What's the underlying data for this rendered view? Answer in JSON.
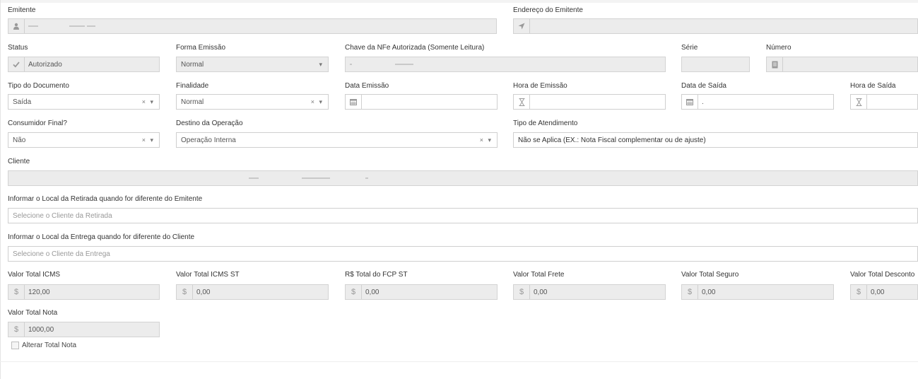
{
  "emitente": {
    "label": "Emitente",
    "icon": "user-icon"
  },
  "endereco": {
    "label": "Endereço do Emitente",
    "icon": "location-arrow-icon"
  },
  "status": {
    "label": "Status",
    "value": "Autorizado",
    "icon": "check-icon"
  },
  "forma_emissao": {
    "label": "Forma Emissão",
    "value": "Normal"
  },
  "chave": {
    "label": "Chave da NFe Autorizada (Somente Leitura)"
  },
  "serie": {
    "label": "Série"
  },
  "numero": {
    "label": "Número",
    "icon": "document-icon"
  },
  "tipo_documento": {
    "label": "Tipo do Documento",
    "value": "Saída",
    "controls": "× ▾"
  },
  "finalidade": {
    "label": "Finalidade",
    "value": "Normal",
    "controls": "× ▾"
  },
  "data_emissao": {
    "label": "Data Emissão",
    "icon": "calendar-icon"
  },
  "hora_emissao": {
    "label": "Hora de Emissão",
    "icon": "hourglass-icon"
  },
  "data_saida": {
    "label": "Data de Saída",
    "icon": "calendar-icon",
    "value": "."
  },
  "hora_saida": {
    "label": "Hora de Saída",
    "icon": "hourglass-icon"
  },
  "consumidor_final": {
    "label": "Consumidor Final?",
    "value": "Não",
    "controls": "× ▾"
  },
  "destino_operacao": {
    "label": "Destino da Operação",
    "value": "Operação Interna",
    "controls": "× ▾"
  },
  "tipo_atendimento": {
    "label": "Tipo de Atendimento",
    "value": "Não se Aplica (EX.: Nota Fiscal complementar ou de ajuste)"
  },
  "cliente": {
    "label": "Cliente"
  },
  "local_retirada": {
    "label": "Informar o Local da Retirada quando for diferente do Emitente",
    "placeholder": "Selecione o Cliente da Retirada"
  },
  "local_entrega": {
    "label": "Informar o Local da Entrega quando for diferente do Cliente",
    "placeholder": "Selecione o Cliente da Entrega"
  },
  "currency_symbol": "$",
  "valor_icms": {
    "label": "Valor Total ICMS",
    "value": "120,00"
  },
  "valor_icms_st": {
    "label": "Valor Total ICMS ST",
    "value": "0,00"
  },
  "total_fcp_st": {
    "label": "R$ Total do FCP ST",
    "value": "0,00"
  },
  "valor_frete": {
    "label": "Valor Total Frete",
    "value": "0,00"
  },
  "valor_seguro": {
    "label": "Valor Total Seguro",
    "value": "0,00"
  },
  "valor_desconto": {
    "label": "Valor Total Desconto",
    "value": "0,00"
  },
  "valor_nota": {
    "label": "Valor Total Nota",
    "value": "1000,00"
  },
  "alterar_total": {
    "label": "Alterar Total Nota"
  }
}
